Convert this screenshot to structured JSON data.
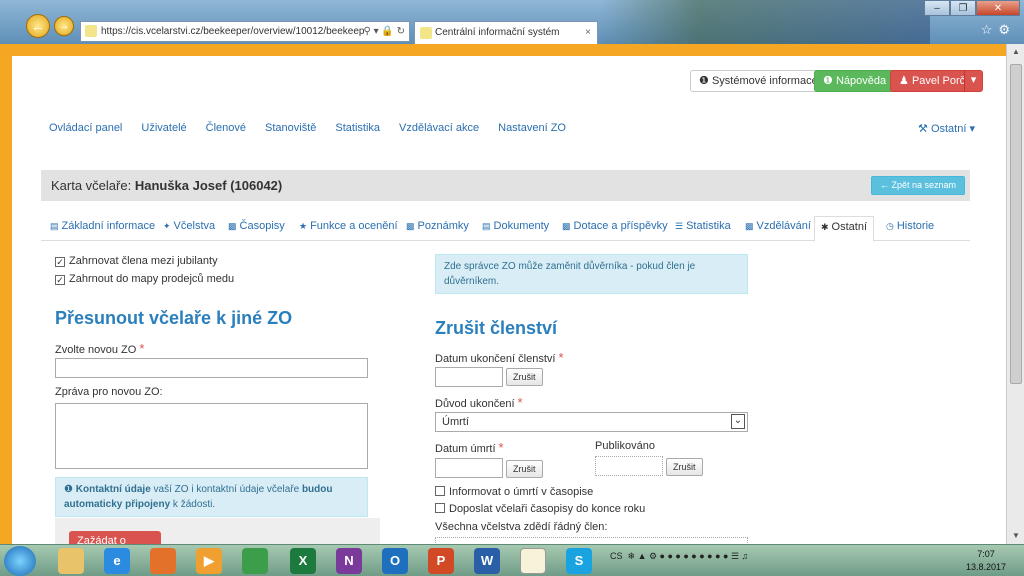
{
  "browser": {
    "url": "https://cis.vcelarstvi.cz/beekeeper/overview/10012/beekeep",
    "tab_title": "Centrální informační systém",
    "tab_close": "×"
  },
  "header_buttons": {
    "system_info": "Systémové informace",
    "help": "Nápověda",
    "user": "Pavel Porč"
  },
  "main_nav": [
    "Ovládací panel",
    "Uživatelé",
    "Členové",
    "Stanoviště",
    "Statistika",
    "Vzdělávací akce",
    "Nastavení ZO"
  ],
  "other_menu": "Ostatní",
  "card": {
    "label": "Karta včelaře:",
    "name": "Hanuška Josef (106042)",
    "back_button": "Zpět na seznam"
  },
  "tabs": [
    "Základní informace",
    "Včelstva",
    "Časopisy",
    "Funkce a ocenění",
    "Poznámky",
    "Dokumenty",
    "Dotace a příspěvky",
    "Statistika",
    "Vzdělávání",
    "Ostatní",
    "Historie"
  ],
  "active_tab": "Ostatní",
  "left": {
    "checkbox_jubilee": "Zahrnovat člena mezi jubilanty",
    "checkbox_map": "Zahrnout do mapy prodejců medu",
    "move_heading": "Přesunout včelaře k jiné ZO",
    "new_zo_label": "Zvolte novou ZO",
    "message_label": "Zpráva pro novou ZO:",
    "info_part1": "Kontaktní údaje",
    "info_part2": " vaší ZO i kontaktní údaje včelaře ",
    "info_part3": "budou automaticky připojeny",
    "info_part4": " k žádosti.",
    "request_button": "Zažádat o přesun"
  },
  "right": {
    "info_text": "Zde správce ZO může zaměnit důvěrníka - pokud člen je důvěrníkem.",
    "cancel_heading": "Zrušit členství",
    "end_date_label": "Datum ukončení členství",
    "clear_button": "Zrušit",
    "reason_label": "Důvod ukončení",
    "reason_value": "Úmrtí",
    "death_date_label": "Datum úmrtí",
    "published_label": "Publikováno",
    "checkbox_inform": "Informovat o úmrtí v časopise",
    "checkbox_send": "Doposlat včelaři časopisy do konce roku",
    "inherit_label": "Všechna včelstva zdědí řádný člen:"
  },
  "taskbar": {
    "lang": "CS",
    "time": "7:07",
    "date": "13.8.2017"
  },
  "colors": {
    "frame": "#f5a623",
    "link": "#2a6fb0",
    "heading": "#2a7fbd",
    "danger": "#d9534f",
    "success": "#5cb85c",
    "info_bg": "#d9edf7"
  }
}
